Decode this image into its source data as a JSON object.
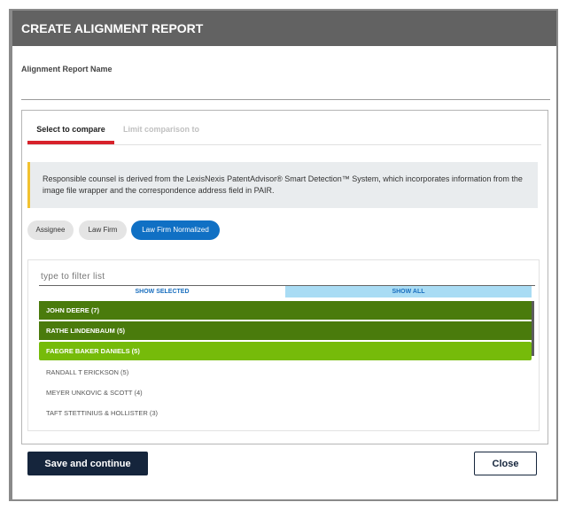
{
  "dialog": {
    "title": "CREATE ALIGNMENT REPORT",
    "report_name_label": "Alignment Report Name",
    "report_name_value": ""
  },
  "tabs": [
    {
      "label": "Select to compare",
      "active": true
    },
    {
      "label": "Limit comparison to",
      "active": false
    }
  ],
  "notice": {
    "text": "Responsible counsel is derived from the LexisNexis PatentAdvisor® Smart Detection™ System, which incorporates information from the image file wrapper and the correspondence address field in PAIR."
  },
  "chips": [
    {
      "label": "Assignee",
      "selected": false
    },
    {
      "label": "Law Firm",
      "selected": false
    },
    {
      "label": "Law Firm Normalized",
      "selected": true
    }
  ],
  "filter": {
    "placeholder": "type to filter list",
    "value": ""
  },
  "toggles": {
    "show_selected": "SHOW SELECTED",
    "show_all": "SHOW ALL"
  },
  "list_items": [
    {
      "label": "JOHN DEERE (7)",
      "state": "selected"
    },
    {
      "label": "RATHE LINDENBAUM (5)",
      "state": "selected"
    },
    {
      "label": "FAEGRE BAKER DANIELS (5)",
      "state": "highlighted"
    },
    {
      "label": "RANDALL T ERICKSON (5)",
      "state": "unselected"
    },
    {
      "label": "MEYER UNKOVIC & SCOTT (4)",
      "state": "unselected"
    },
    {
      "label": "TAFT STETTINIUS & HOLLISTER (3)",
      "state": "unselected"
    }
  ],
  "buttons": {
    "save": "Save and continue",
    "close": "Close"
  },
  "colors": {
    "title_bar": "#626262",
    "active_tab_underline": "#d7222b",
    "notice_accent": "#f2c230",
    "chip_selected": "#1070c4",
    "row_selected": "#4a7b0c",
    "row_highlighted": "#76bb0a",
    "show_all_bg": "#a9dcf4",
    "primary_button": "#15253c"
  }
}
